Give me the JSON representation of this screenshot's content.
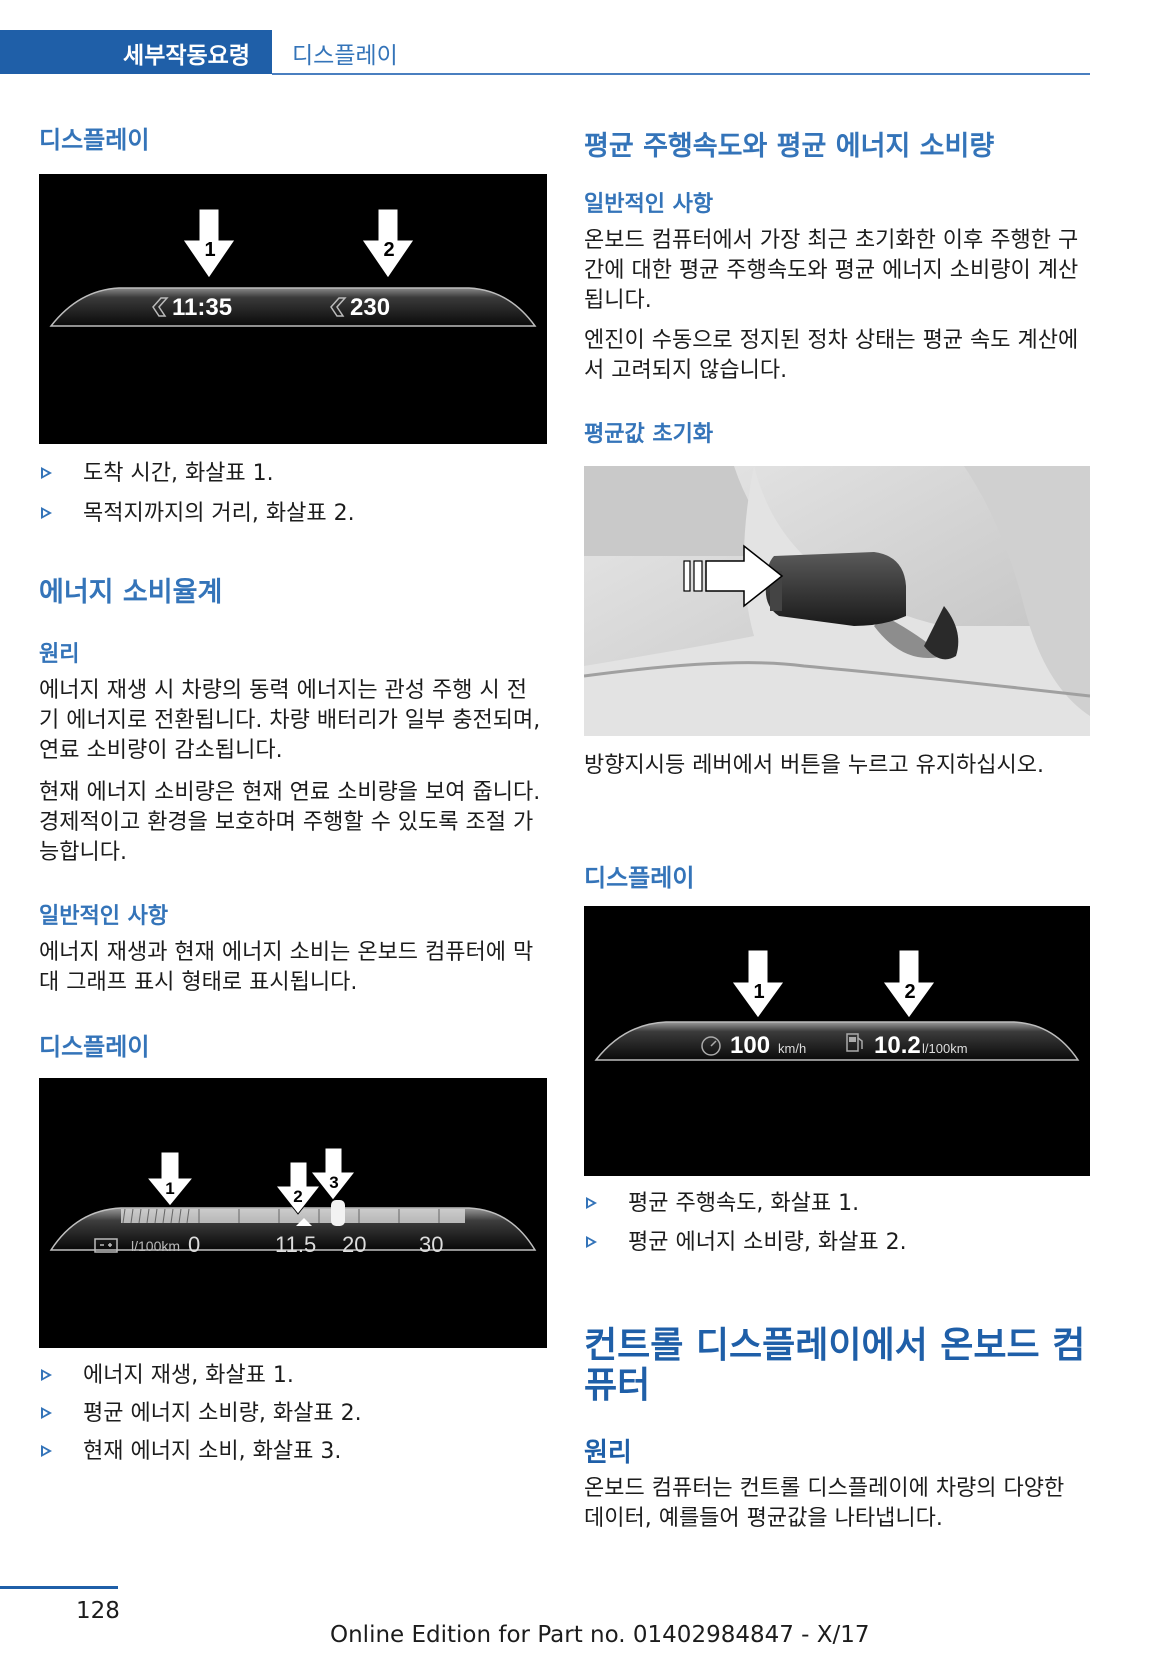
{
  "header": {
    "chapter": "세부작동요령",
    "section": "디스플레이"
  },
  "left": {
    "h_display1": "디스플레이",
    "fig1": {
      "time": "11:35",
      "distance": "230",
      "arrow1": "1",
      "arrow2": "2"
    },
    "bullets1": [
      "도착 시간, 화살표 1.",
      "목적지까지의 거리, 화살표 2."
    ],
    "h_energy": "에너지 소비율계",
    "h_principle": "원리",
    "p_principle1": "에너지 재생 시 차량의 동력 에너지는 관성 주행 시 전기 에너지로 전환됩니다. 차량 배터리가 일부 충전되며, 연료 소비량이 감소됩니다.",
    "p_principle2": "현재 에너지 소비량은 현재 연료 소비량을 보여 줍니다. 경제적이고 환경을 보호하며 주행할 수 있도록 조절 가능합니다.",
    "h_general": "일반적인 사항",
    "p_general": "에너지 재생과 현재 에너지 소비는 온보드 컴퓨터에 막대 그래프 표시 형태로 표시됩니다.",
    "h_display2": "디스플레이",
    "fig2": {
      "unit": "l/100km",
      "v0": "0",
      "avg": "11.5",
      "v20": "20",
      "v30": "30",
      "arrow1": "1",
      "arrow2": "2",
      "arrow3": "3"
    },
    "bullets2": [
      "에너지 재생, 화살표 1.",
      "평균 에너지 소비량, 화살표 2.",
      "현재 에너지 소비, 화살표 3."
    ]
  },
  "right": {
    "h_avg": "평균 주행속도와 평균 에너지 소비량",
    "h_general": "일반적인 사항",
    "p_general1": "온보드 컴퓨터에서 가장 최근 초기화한 이후 주행한 구간에 대한 평균 주행속도와 평균 에너지 소비량이 계산됩니다.",
    "p_general2": "엔진이 수동으로 정지된 정차 상태는 평균 속도 계산에서 고려되지 않습니다.",
    "h_reset": "평균값 초기화",
    "p_reset": "방향지시등 레버에서 버튼을 누르고 유지하십시오.",
    "h_display": "디스플레이",
    "fig4": {
      "speed": "100",
      "speed_unit": "km/h",
      "cons": "10.2",
      "cons_unit": "l/100km",
      "arrow1": "1",
      "arrow2": "2"
    },
    "bullets": [
      "평균 주행속도, 화살표 1.",
      "평균 에너지 소비량, 화살표 2."
    ],
    "h_cd": "컨트롤 디스플레이에서 온보드 컴퓨터",
    "h_principle": "원리",
    "p_principle": "온보드 컴퓨터는 컨트롤 디스플레이에 차량의 다양한 데이터, 예를들어 평균값을 나타냅니다."
  },
  "footer": {
    "page": "128",
    "edition": "Online Edition for Part no. 01402984847 - X/17"
  }
}
